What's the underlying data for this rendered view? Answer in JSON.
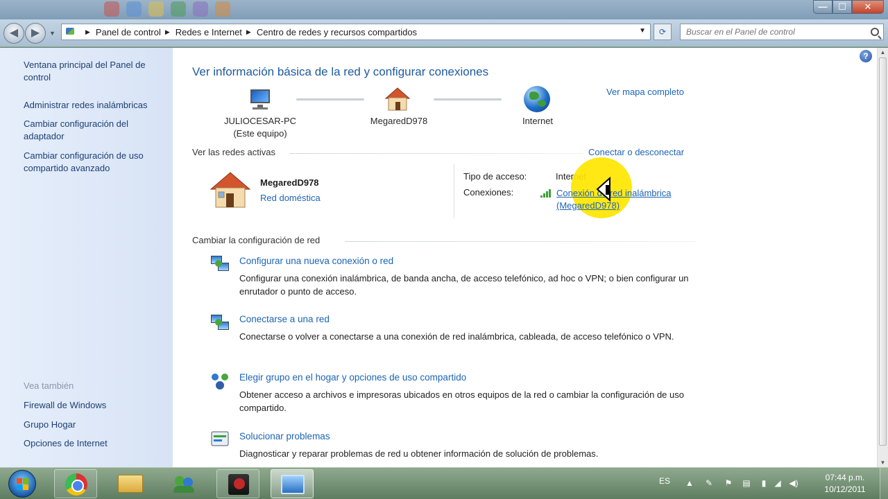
{
  "window": {
    "controls": {
      "minimize": "—",
      "maximize": "☐",
      "close": "✕"
    }
  },
  "navbar": {
    "breadcrumbs": [
      "Panel de control",
      "Redes e Internet",
      "Centro de redes y recursos compartidos"
    ],
    "search_placeholder": "Buscar en el Panel de control"
  },
  "sidebar": {
    "items": [
      {
        "label": "Ventana principal del Panel de control"
      },
      {
        "label": "Administrar redes inalámbricas"
      },
      {
        "label": "Cambiar configuración del adaptador"
      },
      {
        "label": "Cambiar configuración de uso compartido avanzado"
      }
    ],
    "see_also_label": "Vea también",
    "see_also": [
      {
        "label": "Firewall de Windows"
      },
      {
        "label": "Grupo Hogar"
      },
      {
        "label": "Opciones de Internet"
      }
    ]
  },
  "main": {
    "title": "Ver información básica de la red y configurar conexiones",
    "full_map_link": "Ver mapa completo",
    "map": {
      "computer_name": "JULIOCESAR-PC",
      "computer_sub": "(Este equipo)",
      "network_name": "MegaredD978",
      "internet_label": "Internet"
    },
    "active_networks": {
      "header": "Ver las redes activas",
      "connect_link": "Conectar o desconectar",
      "network_name": "MegaredD978",
      "network_type": "Red doméstica",
      "access_type_label": "Tipo de acceso:",
      "access_type_value": "Internet",
      "connections_label": "Conexiones:",
      "connection_line1": "Conexión de red inalámbrica",
      "connection_line2": "(MegaredD978)"
    },
    "change_settings": {
      "header": "Cambiar la configuración de red",
      "tasks": [
        {
          "title": "Configurar una nueva conexión o red",
          "desc": "Configurar una conexión inalámbrica, de banda ancha, de acceso telefónico, ad hoc o VPN; o bien configurar un enrutador o punto de acceso."
        },
        {
          "title": "Conectarse a una red",
          "desc": "Conectarse o volver a conectarse a una conexión de red inalámbrica, cableada, de acceso telefónico o VPN."
        },
        {
          "title": "Elegir grupo en el hogar y opciones de uso compartido",
          "desc": "Obtener acceso a archivos e impresoras ubicados en otros equipos de la red o cambiar la configuración de uso compartido."
        },
        {
          "title": "Solucionar problemas",
          "desc": "Diagnosticar y reparar problemas de red u obtener información de solución de problemas."
        }
      ]
    }
  },
  "taskbar": {
    "language": "ES",
    "time": "07:44 p.m.",
    "date": "10/12/2011"
  }
}
